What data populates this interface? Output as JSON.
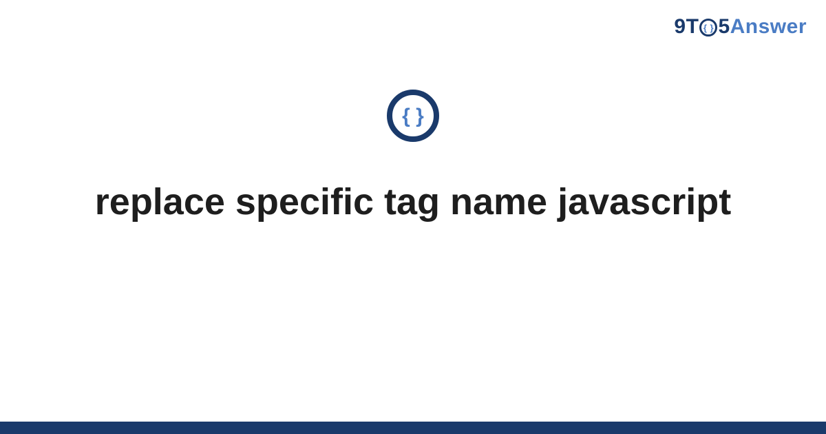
{
  "brand": {
    "prefix": "9T",
    "knob_glyph": "{ }",
    "mid": "5",
    "suffix": "Answer"
  },
  "icon": {
    "name": "code-braces-icon",
    "ring_color": "#1a3a6b",
    "glyph_color": "#4a7cc4"
  },
  "title": "replace specific tag name javascript",
  "colors": {
    "brand_dark": "#1a3a6b",
    "brand_light": "#4a7cc4",
    "text": "#1e1e1e",
    "bar": "#1a3a6b"
  }
}
